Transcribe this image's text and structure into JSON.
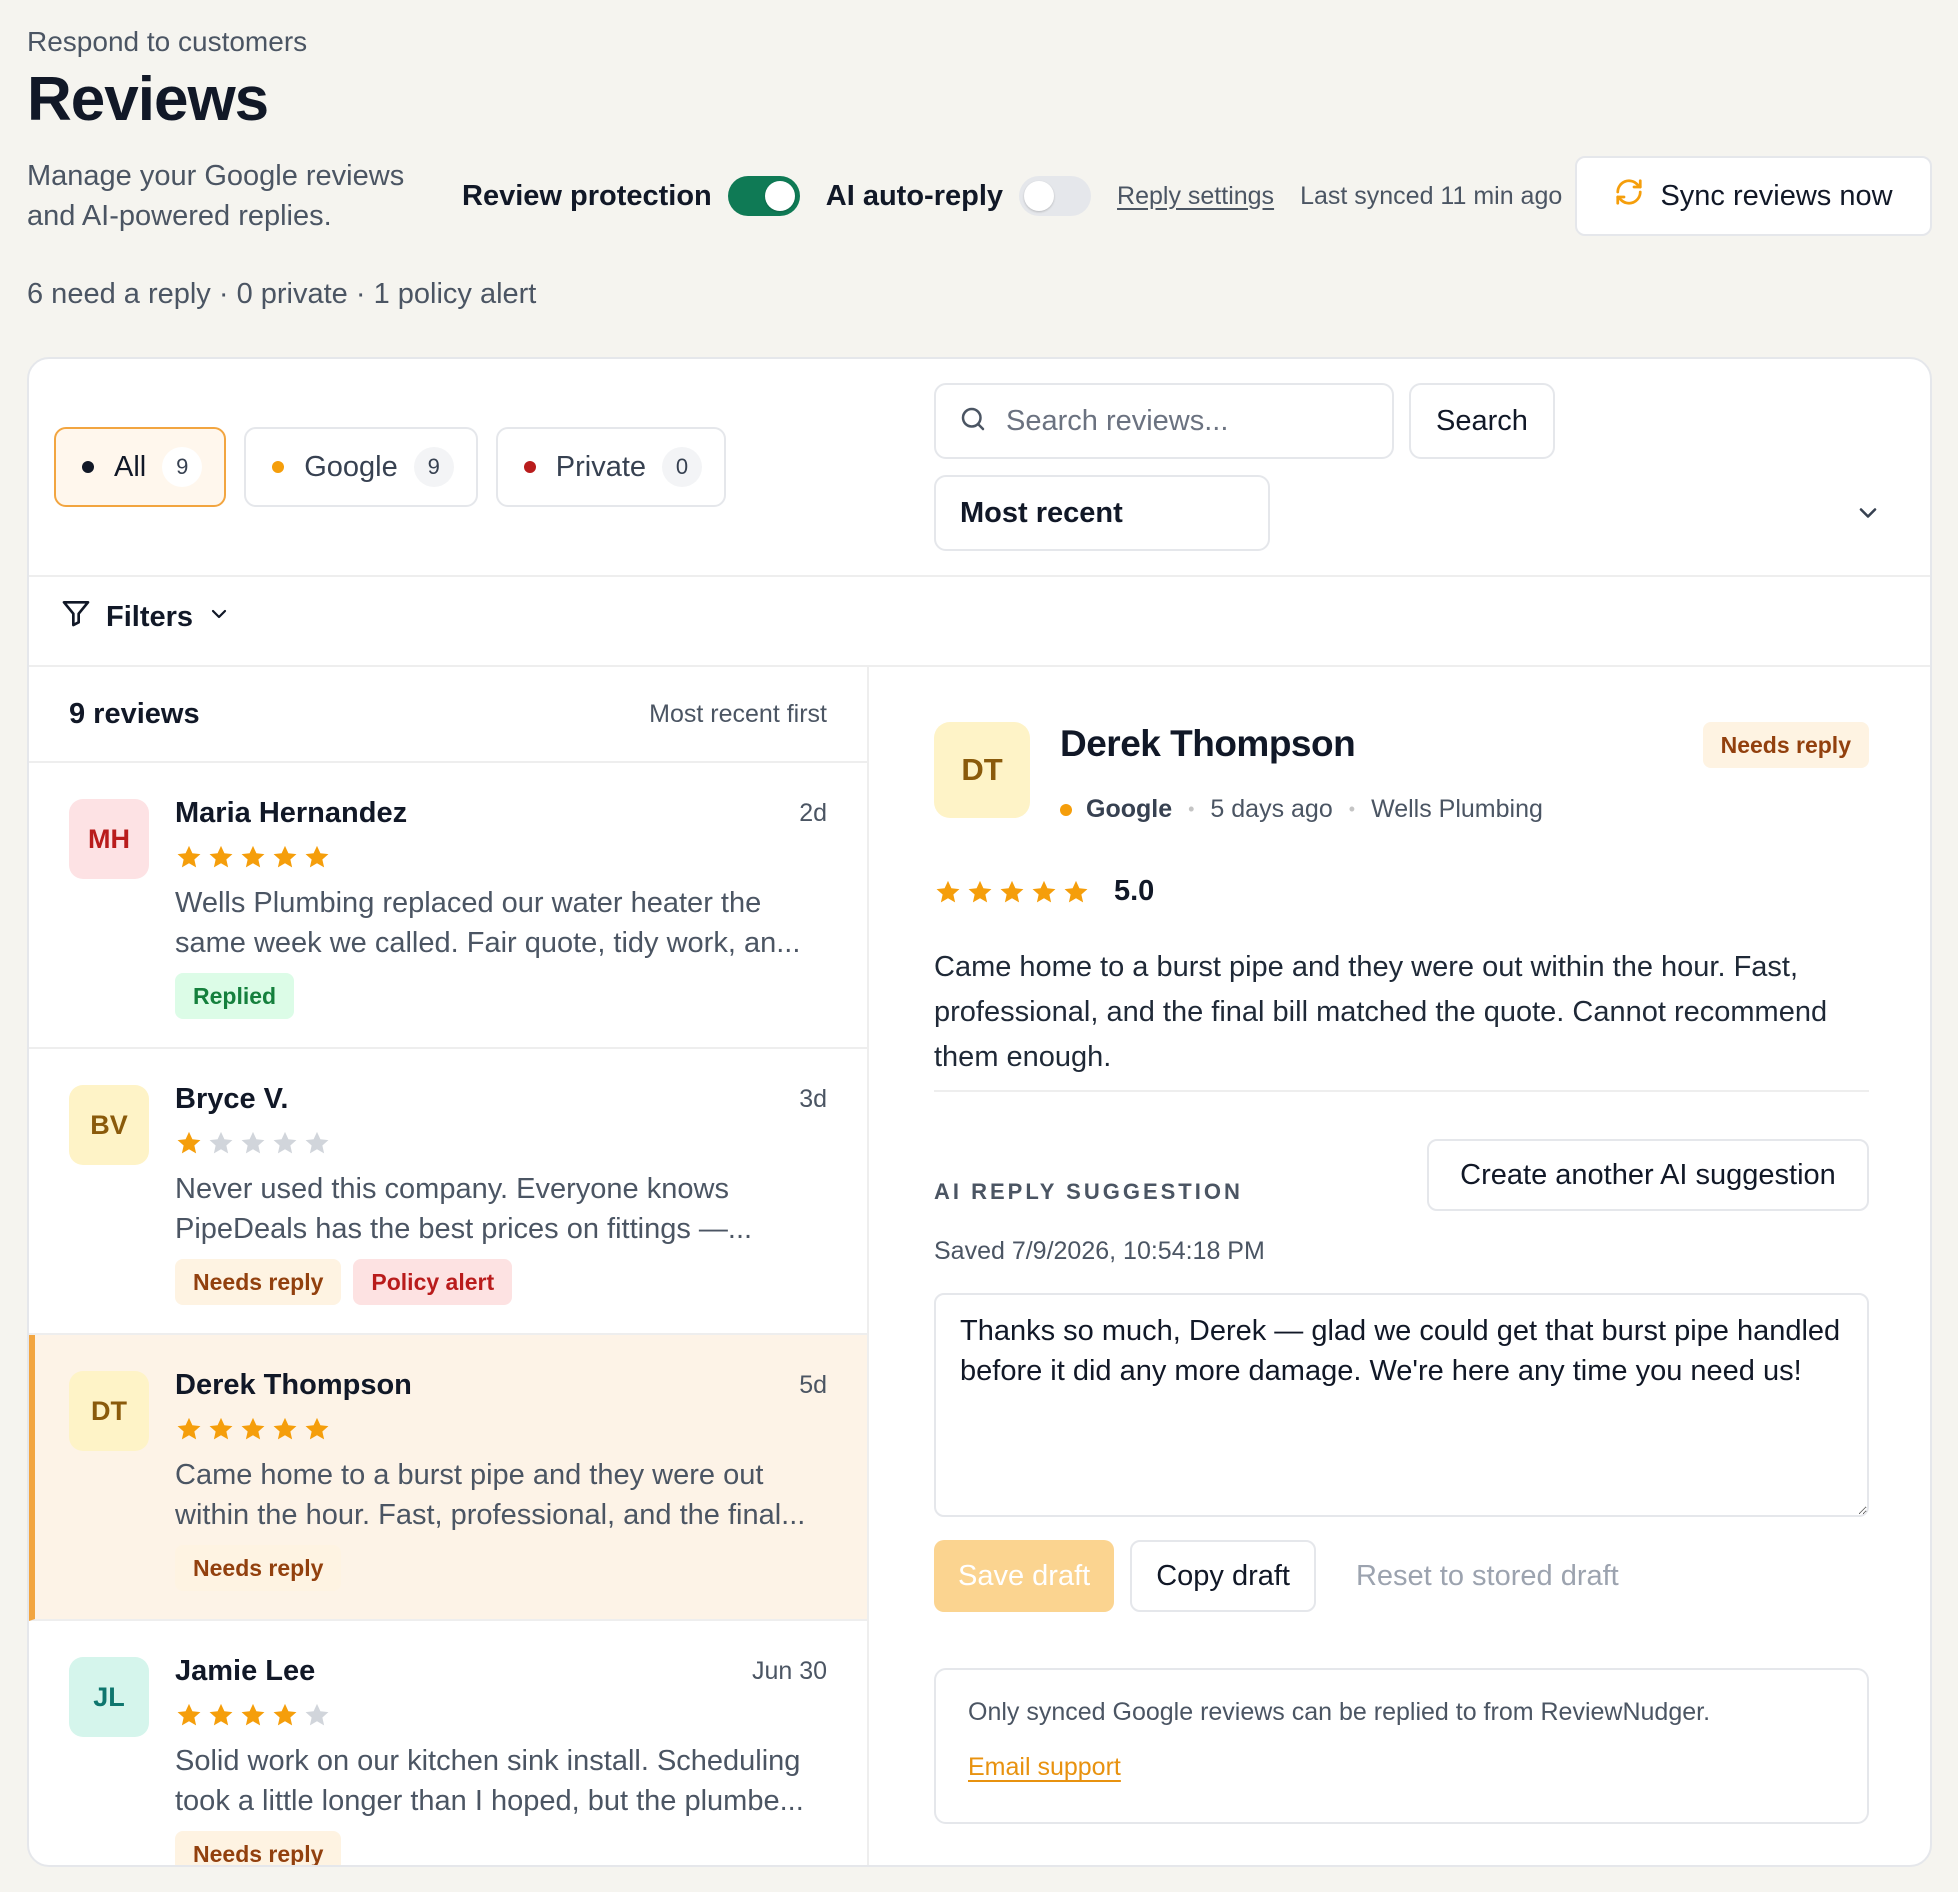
{
  "header": {
    "eyebrow": "Respond to customers",
    "title": "Reviews",
    "subtitle": "Manage your Google reviews and AI-powered replies.",
    "review_protection_label": "Review protection",
    "ai_auto_reply_label": "AI auto-reply",
    "reply_settings_link": "Reply settings",
    "last_synced": "Last synced 11 min ago",
    "sync_button": "Sync reviews now",
    "summary": "6 need a reply · 0 private · 1 policy alert"
  },
  "toggles": {
    "review_protection": true,
    "ai_auto_reply": false
  },
  "tabs": [
    {
      "label": "All",
      "count": "9",
      "dot_color": "#111827",
      "active": true
    },
    {
      "label": "Google",
      "count": "9",
      "dot_color": "#f59e0b",
      "active": false
    },
    {
      "label": "Private",
      "count": "0",
      "dot_color": "#b91c1c",
      "active": false
    }
  ],
  "search": {
    "placeholder": "Search reviews...",
    "button": "Search"
  },
  "sort": {
    "selected": "Most recent"
  },
  "filters_label": "Filters",
  "list": {
    "count_label": "9 reviews",
    "sort_label": "Most recent first",
    "items": [
      {
        "initials": "MH",
        "name": "Maria Hernandez",
        "date": "2d",
        "rating": 5,
        "text": "Wells Plumbing replaced our water heater the same week we called. Fair quote, tidy work, an...",
        "badges": [
          {
            "label": "Replied",
            "kind": "replied"
          }
        ],
        "avatar_bg": "#fde2e4",
        "avatar_fg": "#b91c1c"
      },
      {
        "initials": "BV",
        "name": "Bryce V.",
        "date": "3d",
        "rating": 1,
        "text": "Never used this company. Everyone knows PipeDeals has the best prices on fittings —...",
        "badges": [
          {
            "label": "Needs reply",
            "kind": "needs"
          },
          {
            "label": "Policy alert",
            "kind": "policy"
          }
        ],
        "avatar_bg": "#fef3c7",
        "avatar_fg": "#8a5a0b"
      },
      {
        "initials": "DT",
        "name": "Derek Thompson",
        "date": "5d",
        "rating": 5,
        "text": "Came home to a burst pipe and they were out within the hour. Fast, professional, and the final...",
        "badges": [
          {
            "label": "Needs reply",
            "kind": "needs"
          }
        ],
        "avatar_bg": "#fef3c7",
        "avatar_fg": "#8a5a0b",
        "selected": true
      },
      {
        "initials": "JL",
        "name": "Jamie Lee",
        "date": "Jun 30",
        "rating": 4,
        "text": "Solid work on our kitchen sink install. Scheduling took a little longer than I hoped, but the plumbe...",
        "badges": [
          {
            "label": "Needs reply",
            "kind": "needs"
          }
        ],
        "avatar_bg": "#d5f5ec",
        "avatar_fg": "#0f766e"
      }
    ]
  },
  "detail": {
    "initials": "DT",
    "name": "Derek Thompson",
    "status_badge": "Needs reply",
    "source": "Google",
    "time_ago": "5 days ago",
    "business": "Wells Plumbing",
    "rating": 5,
    "score": "5.0",
    "text": "Came home to a burst pipe and they were out within the hour. Fast, professional, and the final bill matched the quote. Cannot recommend them enough.",
    "ai_label": "AI REPLY SUGGESTION",
    "ai_button": "Create another AI suggestion",
    "saved": "Saved 7/9/2026, 10:54:18 PM",
    "reply": "Thanks so much, Derek — glad we could get that burst pipe handled before it did any more damage. We're here any time you need us!",
    "save_button": "Save draft",
    "copy_button": "Copy draft",
    "reset_button": "Reset to stored draft",
    "notice": "Only synced Google reviews can be replied to from ReviewNudger.",
    "notice_link": "Email support"
  },
  "colors": {
    "accent": "#f2a540",
    "star": "#f59e0b",
    "star_empty": "#d1d5db",
    "toggle_on": "#0f7a55"
  }
}
